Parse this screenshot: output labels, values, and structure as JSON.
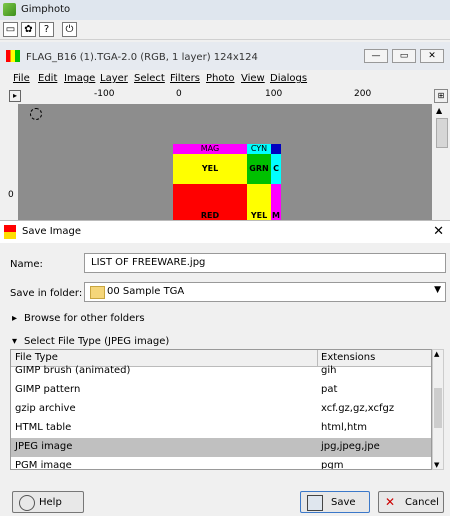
{
  "app": {
    "title": "Gimphoto"
  },
  "app_toolbar": [
    "▭",
    "✿",
    "?",
    "⏻"
  ],
  "image_window": {
    "title": "FLAG_B16 (1).TGA-2.0 (RGB, 1 layer) 124x124",
    "menu": [
      "File",
      "Edit",
      "Image",
      "Layer",
      "Select",
      "Filters",
      "Photo",
      "View",
      "Dialogs"
    ],
    "ruler_labels": [
      "-100",
      "0",
      "100",
      "200"
    ],
    "vruler_labels": [
      "0"
    ],
    "canvas_labels": {
      "mag": "MAG",
      "cyn": "CYN",
      "yel": "YEL",
      "grn": "GRN",
      "c": "C",
      "red": "RED",
      "yel2": "YEL",
      "m": "M"
    },
    "colors": {
      "magenta": "#ff00ff",
      "cyan": "#00ffff",
      "yellow": "#ffff00",
      "green": "#00c000",
      "red": "#ff0000",
      "blue": "#0000c0"
    }
  },
  "dialog": {
    "title": "Save Image",
    "name_label": "Name:",
    "name_value": "LIST OF FREEWARE.jpg",
    "folder_label": "Save in folder:",
    "folder_value": "00 Sample TGA",
    "browse_label": "Browse for other folders",
    "filetype_label": "Select File Type (JPEG image)",
    "table": {
      "headers": [
        "File Type",
        "Extensions"
      ],
      "rows": [
        {
          "type": "GIMP brush (animated)",
          "ext": "gih"
        },
        {
          "type": "GIMP pattern",
          "ext": "pat"
        },
        {
          "type": "gzip archive",
          "ext": "xcf.gz,gz,xcfgz"
        },
        {
          "type": "HTML table",
          "ext": "html,htm"
        },
        {
          "type": "JPEG image",
          "ext": "jpg,jpeg,jpe"
        },
        {
          "type": "PGM image",
          "ext": "pgm"
        }
      ],
      "selected_index": 4
    },
    "buttons": {
      "help": "Help",
      "save": "Save",
      "cancel": "Cancel"
    }
  }
}
